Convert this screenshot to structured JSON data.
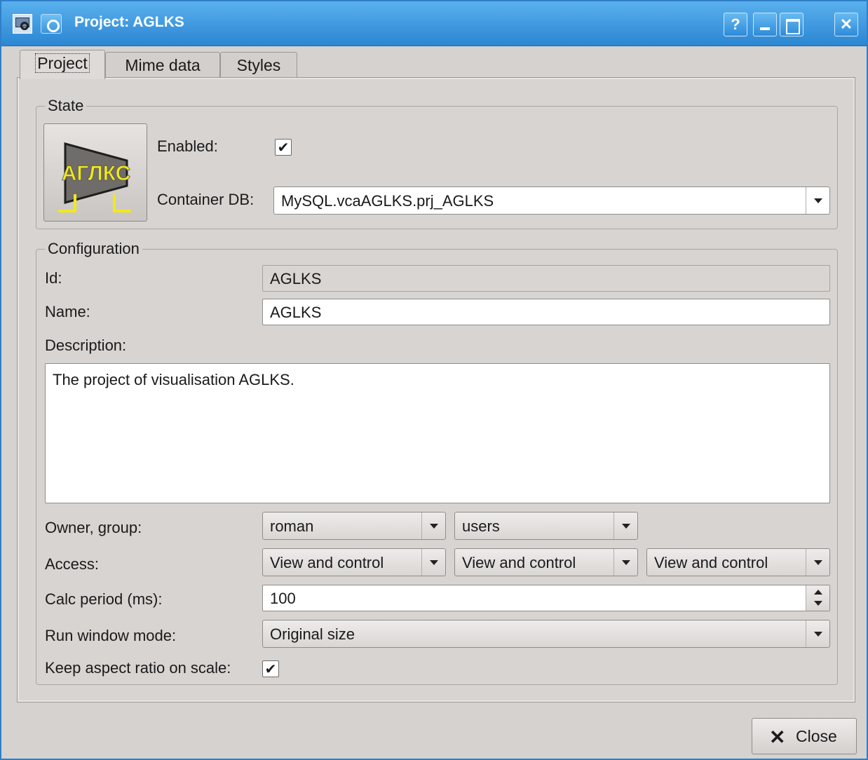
{
  "window": {
    "title": "Project: AGLKS",
    "help_label": "?",
    "close_label": "✕"
  },
  "tabs": [
    {
      "label": "Project",
      "active": true
    },
    {
      "label": "Mime data",
      "active": false
    },
    {
      "label": "Styles",
      "active": false
    }
  ],
  "state": {
    "group_title": "State",
    "project_icon_text": "АГЛКС",
    "enabled_label": "Enabled:",
    "enabled_checked": true,
    "container_db_label": "Container DB:",
    "container_db_value": "MySQL.vcaAGLKS.prj_AGLKS"
  },
  "config": {
    "group_title": "Configuration",
    "id_label": "Id:",
    "id_value": "AGLKS",
    "name_label": "Name:",
    "name_value": "AGLKS",
    "description_label": "Description:",
    "description_value": "The project of visualisation AGLKS.",
    "owner_group_label": "Owner, group:",
    "owner_value": "roman",
    "group_value": "users",
    "access_label": "Access:",
    "access_values": [
      "View and control",
      "View and control",
      "View and control"
    ],
    "calc_period_label": "Calc period (ms):",
    "calc_period_value": "100",
    "run_window_mode_label": "Run window mode:",
    "run_window_mode_value": "Original size",
    "keep_aspect_label": "Keep aspect ratio on scale:",
    "keep_aspect_checked": true
  },
  "footer": {
    "close_button_label": "Close"
  },
  "colors": {
    "titlebar": "#3d8fd4",
    "background": "#d6d2d0",
    "logo_text": "#f2e81a"
  }
}
